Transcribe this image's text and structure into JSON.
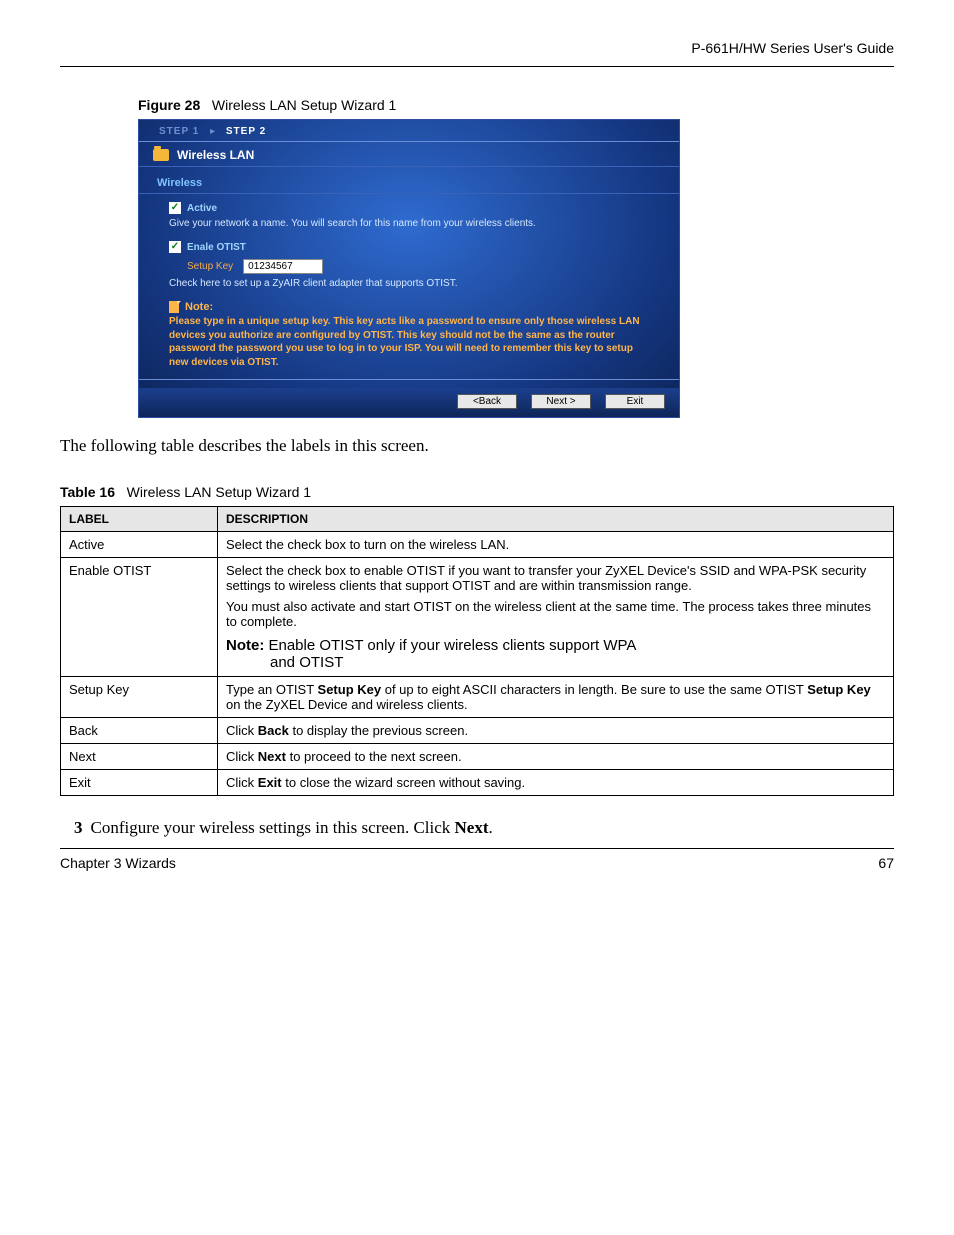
{
  "header": {
    "guide": "P-661H/HW Series User's Guide"
  },
  "figure": {
    "label": "Figure 28",
    "title": "Wireless LAN Setup Wizard 1"
  },
  "wizard": {
    "steps": {
      "s1": "STEP 1",
      "s2": "STEP 2"
    },
    "title": "Wireless LAN",
    "section": "Wireless",
    "active_label": "Active",
    "active_hint": "Give your network a name. You will search for this name from your wireless clients.",
    "otist_label": "Enale OTIST",
    "setup_key_label": "Setup Key",
    "setup_key_value": "01234567",
    "otist_hint": "Check here to set up a ZyAIR client adapter that supports OTIST.",
    "note_head": "Note:",
    "note_body": "Please type in a unique setup key. This key acts like a password to ensure only those wireless LAN devices you authorize are configured by OTIST. This key should not be the same as the router password the password you use to log in to your ISP. You will need to remember this key to setup new devices via OTIST.",
    "btn_back": "<Back",
    "btn_next": "Next >",
    "btn_exit": "Exit"
  },
  "intro_text": "The following table describes the labels in this screen.",
  "table_caption": {
    "label": "Table 16",
    "title": "Wireless LAN Setup Wizard 1"
  },
  "table": {
    "h_label": "LABEL",
    "h_desc": "DESCRIPTION",
    "rows": {
      "active": {
        "label": "Active",
        "desc": "Select the check box to turn on the wireless LAN."
      },
      "otist": {
        "label": "Enable OTIST",
        "p1": "Select the check box to enable OTIST if you want to transfer your ZyXEL Device's SSID and WPA-PSK security settings to wireless clients that support OTIST and are within transmission range.",
        "p2": "You must also activate and start OTIST on the wireless client at the same time. The process takes three minutes to complete.",
        "note_b": "Note:",
        "note_rest": " Enable OTIST only if your wireless clients support WPA",
        "note_line2": "and OTIST"
      },
      "setup": {
        "label": "Setup Key",
        "pre1": "Type an OTIST ",
        "b1": "Setup Key",
        "mid1": " of up to eight ASCII characters in length. Be sure to use the same OTIST ",
        "b2": "Setup Key",
        "post1": " on the ZyXEL Device and wireless clients."
      },
      "back": {
        "label": "Back",
        "pre": "Click ",
        "b": "Back",
        "post": " to display the previous screen."
      },
      "next": {
        "label": "Next",
        "pre": "Click ",
        "b": "Next",
        "post": " to proceed to the next screen."
      },
      "exit": {
        "label": "Exit",
        "pre": "Click ",
        "b": "Exit",
        "post": " to close the wizard screen without saving."
      }
    }
  },
  "step3": {
    "num": "3",
    "pre": "Configure your wireless settings in this screen. Click ",
    "b": "Next",
    "post": "."
  },
  "footer": {
    "left": "Chapter 3 Wizards",
    "right": "67"
  }
}
